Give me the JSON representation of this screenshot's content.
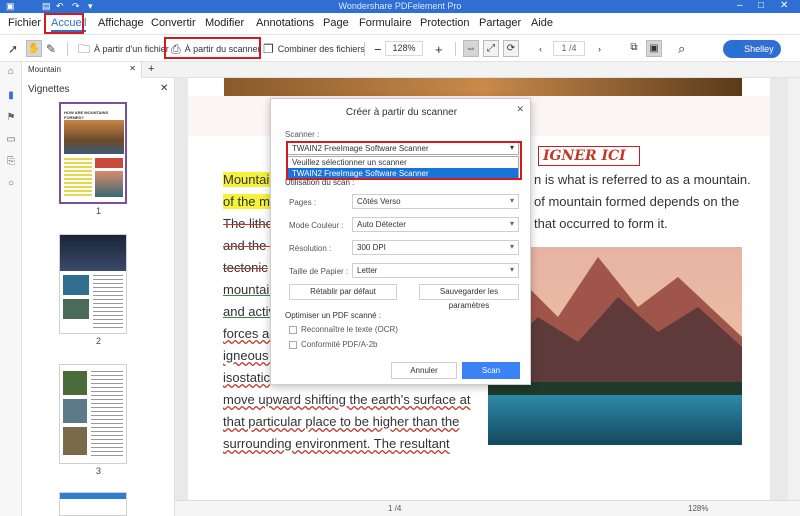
{
  "titlebar": {
    "title": "Wondershare PDFelement Pro"
  },
  "menu": {
    "items": [
      "Fichier",
      "Accueil",
      "Affichage",
      "Convertir",
      "Modifier",
      "Annotations",
      "Page",
      "Formulaire",
      "Protection",
      "Partager",
      "Aide"
    ],
    "active": "Accueil"
  },
  "toolbar": {
    "from_file": "À partir d'un fichier",
    "from_scanner": "À partir du scanner",
    "combine": "Combiner des fichiers",
    "zoom": "128%",
    "page": "1 /4",
    "user": "Shelley"
  },
  "tab": {
    "label": "Mountain"
  },
  "thumbs": {
    "title": "Vignettes",
    "pages": [
      "1",
      "2",
      "3"
    ],
    "page1_heading": "HOW ARE MOUNTAINS FORMED?"
  },
  "document": {
    "lines_left": [
      "Mountain",
      "of the mo",
      "The lithos",
      "and the c",
      "tectonic",
      "mountain",
      "and activ",
      "forces ac",
      "igneous t",
      "isostatic",
      "move upward shifting the earth's surface at",
      "that particular place to be higher than the",
      "surrounding environment. The resultant"
    ],
    "lines_right": [
      "n is what is referred to as a mountain.",
      "of mountain formed depends on the",
      "that occurred to form it."
    ],
    "signature_text": "IGNER ICI"
  },
  "dialog": {
    "title": "Créer à partir du scanner",
    "scanner_label": "Scanner :",
    "scanner_value": "TWAIN2 FreeImage Software Scanner",
    "dropdown_options": [
      "Veuillez sélectionner un scanner",
      "TWAIN2 FreeImage Software Scanner"
    ],
    "scan_settings_label": "Utilisation du scan :",
    "pages_label": "Pages :",
    "pages_value": "Côtés Verso",
    "color_label": "Mode Couleur :",
    "color_value": "Auto Détecter",
    "resolution_label": "Résolution :",
    "resolution_value": "300 DPI",
    "paper_label": "Taille de Papier :",
    "paper_value": "Letter",
    "reset_button": "Rétablir par défaut",
    "save_button": "Sauvegarder les paramètres",
    "optimize_label": "Optimiser un PDF scanné :",
    "ocr_label": "Reconnaître le texte (OCR)",
    "pdfa_label": "Conformité PDF/A-2b",
    "cancel_button": "Annuler",
    "scan_button": "Scan"
  },
  "status": {
    "page": "1 /4",
    "zoom": "128%"
  },
  "colors": {
    "accent": "#2f6fd4",
    "highlight_red": "#d21c1c",
    "selection_blue": "#1a73d9"
  }
}
